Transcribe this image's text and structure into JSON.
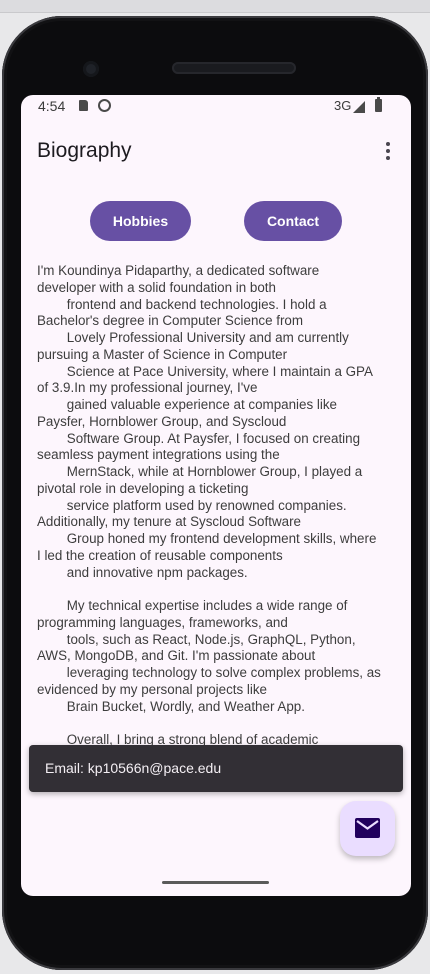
{
  "status_bar": {
    "time": "4:54",
    "network": "3G"
  },
  "app_bar": {
    "title": "Biography"
  },
  "buttons": {
    "hobbies": "Hobbies",
    "contact": "Contact"
  },
  "bio_lines": [
    "I'm Koundinya Pidaparthy, a dedicated software",
    "developer with a solid foundation in both",
    "        frontend and backend technologies. I hold a",
    "Bachelor's degree in Computer Science from",
    "        Lovely Professional University and am currently",
    "pursuing a Master of Science in Computer",
    "        Science at Pace University, where I maintain a GPA",
    "of 3.9.In my professional journey, I've",
    "        gained valuable experience at companies like",
    "Paysfer, Hornblower Group, and Syscloud",
    "        Software Group. At Paysfer, I focused on creating",
    "seamless payment integrations using the",
    "        MernStack, while at Hornblower Group, I played a",
    "pivotal role in developing a ticketing",
    "        service platform used by renowned companies.",
    "Additionally, my tenure at Syscloud Software",
    "        Group honed my frontend development skills, where",
    "I led the creation of reusable components",
    "        and innovative npm packages.",
    "",
    "        My technical expertise includes a wide range of",
    "programming languages, frameworks, and",
    "        tools, such as React, Node.js, GraphQL, Python,",
    "AWS, MongoDB, and Git. I'm passionate about",
    "        leveraging technology to solve complex problems, as",
    "evidenced by my personal projects like",
    "        Brain Bucket, Wordly, and Weather App.",
    "",
    "        Overall, I bring a strong blend of academic"
  ],
  "snackbar": {
    "text": "Email: kp10566n@pace.edu"
  },
  "fab": {
    "icon": "mail-icon"
  },
  "colors": {
    "primary": "#6750a4",
    "fab_bg": "#eaddff",
    "screen_bg": "#fdf6fd",
    "snackbar_bg": "#322f35"
  }
}
